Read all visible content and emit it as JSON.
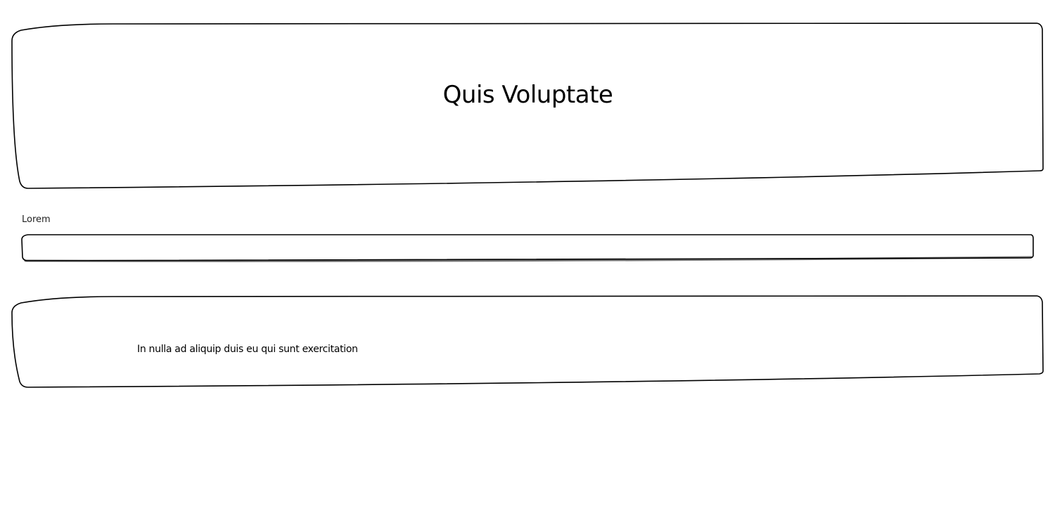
{
  "header": {
    "title": "Quis Voluptate"
  },
  "form": {
    "field_label": "Lorem",
    "field_value": "",
    "field_placeholder": ""
  },
  "content": {
    "text": "In nulla ad aliquip duis eu qui sunt exercitation"
  }
}
